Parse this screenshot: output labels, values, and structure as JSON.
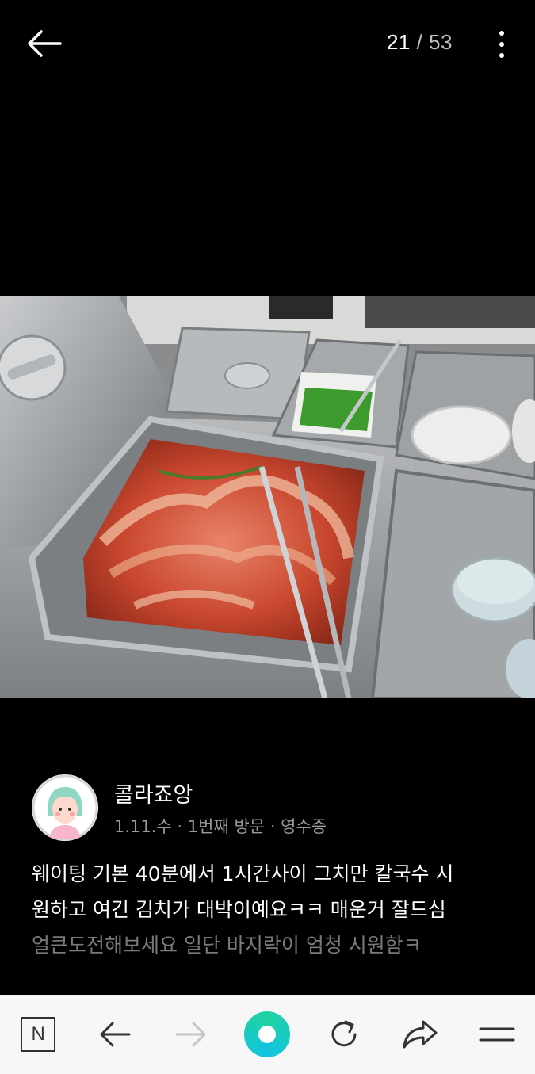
{
  "viewer": {
    "current": "21",
    "separator": "/",
    "total": "53"
  },
  "post": {
    "author_name": "콜라죠앙",
    "meta": "1.11.수 · 1번째 방문 · 영수증",
    "review_lines": [
      "웨이팅 기본 40분에서 1시간사이 그치만 칼국수 시",
      "원하고 여긴 김치가 대박이예요ㅋㅋ 매운거 잘드심",
      "얼큰도전해보세요 일단 바지락이 엄청 시원함ㅋ"
    ]
  },
  "icons": {
    "back": "arrow-left-icon",
    "menu": "more-vertical-icon",
    "naver": "naver-n-icon",
    "nav_back": "arrow-left-icon",
    "nav_forward": "arrow-right-icon",
    "home": "home-circle-icon",
    "refresh": "refresh-icon",
    "share": "share-arrow-icon",
    "hamburger": "hamburger-menu-icon"
  },
  "colors": {
    "background": "#000000",
    "bottom_bar": "#f7f7f7",
    "home_accent": "#1fd3a0",
    "meta_text": "#9a9a9a"
  }
}
